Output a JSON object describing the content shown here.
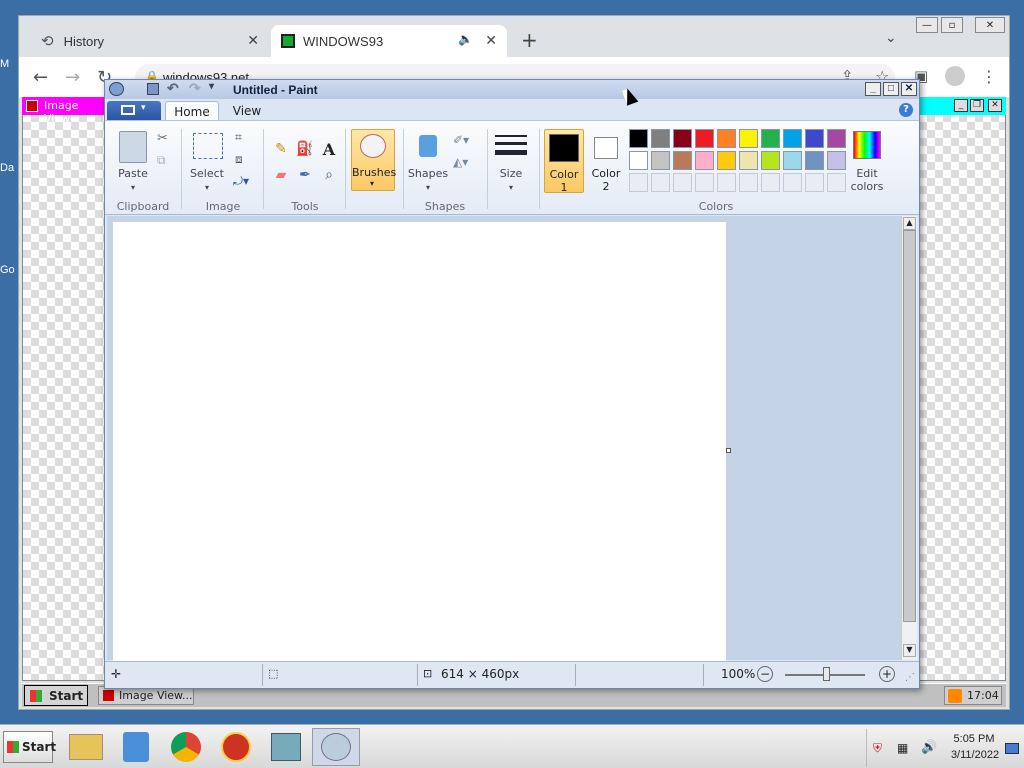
{
  "desktop": {
    "labels": [
      "M",
      "Da",
      "Go"
    ]
  },
  "chrome": {
    "tabs": [
      {
        "label": "History",
        "icon": "history-icon"
      },
      {
        "label": "WINDOWS93",
        "icon": "windows93-icon",
        "audio": true
      }
    ],
    "new_tab": "+",
    "url": "windows93.net"
  },
  "image_viewer": {
    "title": "Image Viewer",
    "taskbar_label": "Image View...",
    "start": "Start",
    "clock": "17:04"
  },
  "paint": {
    "title": "Untitled - Paint",
    "tabs": [
      "Home",
      "View"
    ],
    "groups": {
      "clipboard": {
        "label": "Clipboard",
        "paste": "Paste"
      },
      "image": {
        "label": "Image",
        "select": "Select"
      },
      "tools": {
        "label": "Tools"
      },
      "brushes": {
        "label": "Brushes"
      },
      "shapes": {
        "label": "Shapes",
        "shapes_btn": "Shapes"
      },
      "size": {
        "label": "Size"
      },
      "colors": {
        "label": "Colors",
        "color1": "Color\n1",
        "color1_a": "Color",
        "color1_b": "1",
        "color2_a": "Color",
        "color2_b": "2",
        "edit_a": "Edit",
        "edit_b": "colors"
      }
    },
    "palette": [
      "#000000",
      "#7f7f7f",
      "#880015",
      "#ed1c24",
      "#ff7f27",
      "#fff200",
      "#22b14c",
      "#00a2e8",
      "#3f48cc",
      "#a349a4",
      "#ffffff",
      "#c3c3c3",
      "#b97a57",
      "#ffaec9",
      "#ffc90e",
      "#efe4b0",
      "#b5e61d",
      "#99d9ea",
      "#7092be",
      "#c8bfe7"
    ],
    "status": {
      "dimensions": "614 × 460px",
      "zoom": "100%",
      "zoom_out": "−",
      "zoom_in": "+"
    }
  },
  "taskbar": {
    "start": "Start",
    "apps": [
      "file-explorer-icon",
      "media-player-icon",
      "chrome-icon",
      "app-icon",
      "control-panel-icon",
      "paint-icon"
    ],
    "time": "5:05 PM",
    "date": "3/11/2022"
  }
}
